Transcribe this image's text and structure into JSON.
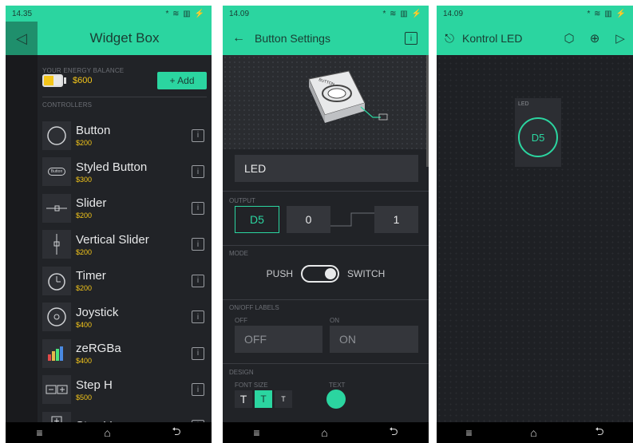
{
  "colors": {
    "accent": "#2bd5a0",
    "background": "#212327",
    "price": "#f3c51a"
  },
  "phone1": {
    "status": {
      "time": "14.35",
      "right": "* ≋ ▥ ⚡"
    },
    "header": {
      "title": "Widget Box"
    },
    "energy": {
      "caption": "YOUR ENERGY BALANCE",
      "balance": "600",
      "add_label": "+ Add"
    },
    "controllers_caption": "CONTROLLERS",
    "widgets": [
      {
        "name": "Button",
        "price": "200",
        "icon": "circle-icon"
      },
      {
        "name": "Styled Button",
        "price": "300",
        "icon": "styled-button-icon"
      },
      {
        "name": "Slider",
        "price": "200",
        "icon": "slider-icon"
      },
      {
        "name": "Vertical Slider",
        "price": "200",
        "icon": "vertical-slider-icon"
      },
      {
        "name": "Timer",
        "price": "200",
        "icon": "timer-icon"
      },
      {
        "name": "Joystick",
        "price": "400",
        "icon": "joystick-icon"
      },
      {
        "name": "zeRGBa",
        "price": "400",
        "icon": "zergba-icon"
      },
      {
        "name": "Step H",
        "price": "500",
        "icon": "step-h-icon"
      },
      {
        "name": "Step V",
        "price": "",
        "icon": "step-v-icon"
      }
    ],
    "styled_button_thumb": "Button",
    "nav": [
      "≡",
      "⌂",
      "⮌"
    ]
  },
  "phone2": {
    "status": {
      "time": "14.09",
      "right": "* ≋ ▥ ⚡"
    },
    "header": {
      "title": "Button Settings",
      "info": "i"
    },
    "preview_label": "BUTTON",
    "name_value": "LED",
    "output": {
      "caption": "OUTPUT",
      "pin": "D5",
      "low": "0",
      "high": "1"
    },
    "mode": {
      "caption": "MODE",
      "left": "PUSH",
      "right": "SWITCH"
    },
    "labels": {
      "caption": "ON/OFF LABELS",
      "off_caption": "OFF",
      "on_caption": "ON",
      "off_value": "OFF",
      "on_value": "ON"
    },
    "design": {
      "caption": "DESIGN",
      "font_size_caption": "FONT SIZE",
      "text_caption": "TEXT",
      "sizes": [
        "T",
        "T",
        "T"
      ]
    },
    "nav": [
      "≡",
      "⌂",
      "⮌"
    ]
  },
  "phone3": {
    "status": {
      "time": "14.09",
      "right": "* ≋ ▥ ⚡"
    },
    "header": {
      "title": "Kontrol LED"
    },
    "led": {
      "label": "LED",
      "pin": "D5"
    },
    "nav": [
      "≡",
      "⌂",
      "⮌"
    ]
  }
}
